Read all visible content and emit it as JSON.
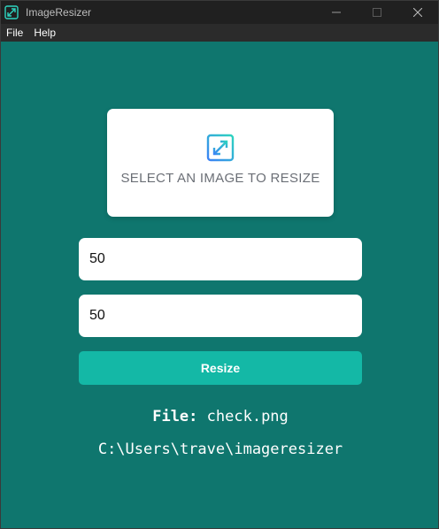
{
  "window": {
    "title": "ImageResizer"
  },
  "menu": {
    "items": [
      {
        "label": "File"
      },
      {
        "label": "Help"
      }
    ]
  },
  "dropzone": {
    "icon": "expand-icon",
    "label": "SELECT AN IMAGE TO RESIZE"
  },
  "form": {
    "width_value": "50",
    "height_value": "50",
    "resize_label": "Resize"
  },
  "output": {
    "file_prefix": "File:",
    "file_name": "check.png",
    "path": "C:\\Users\\trave\\imageresizer"
  },
  "colors": {
    "background": "#0f766e",
    "accent": "#14b8a6",
    "icon_gradient_start": "#3b82f6",
    "icon_gradient_end": "#2dd4bf"
  }
}
